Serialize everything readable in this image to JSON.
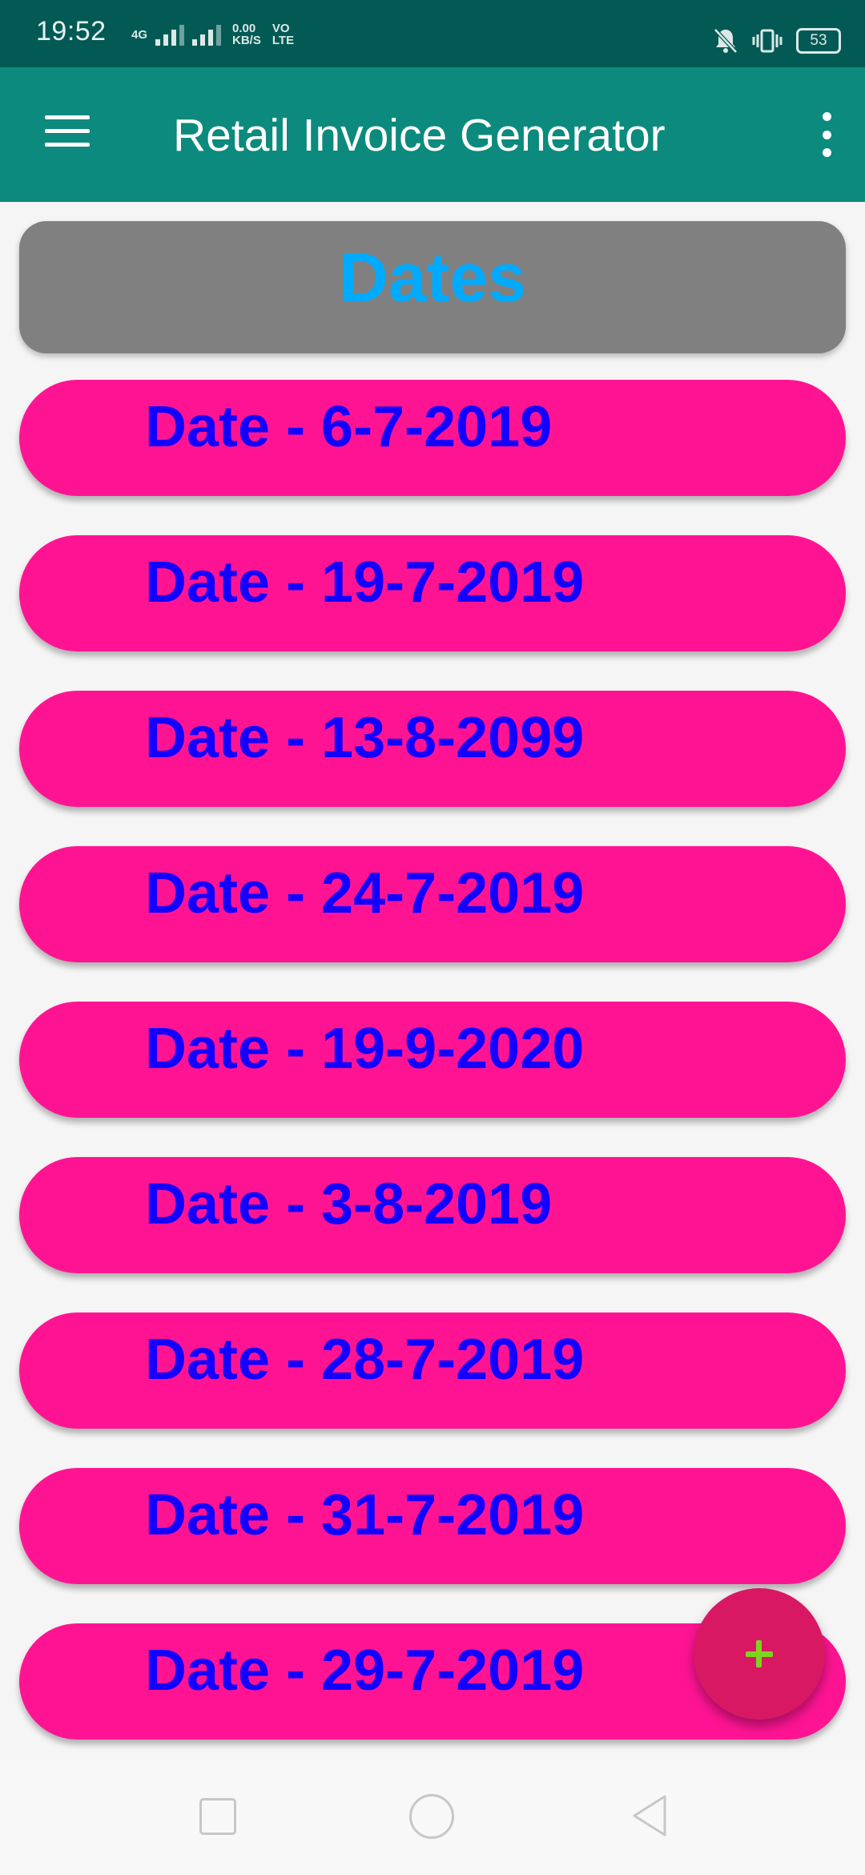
{
  "status_bar": {
    "time": "19:52",
    "network_type": "4G",
    "data_speed_value": "0.00",
    "data_speed_unit": "KB/S",
    "volte_top": "VO",
    "volte_bottom": "LTE",
    "battery_level": "53"
  },
  "app_bar": {
    "title": "Retail Invoice Generator"
  },
  "header": {
    "title": "Dates"
  },
  "dates": [
    "Date - 6-7-2019",
    "Date - 19-7-2019",
    "Date - 13-8-2099",
    "Date - 24-7-2019",
    "Date - 19-9-2020",
    "Date - 3-8-2019",
    "Date - 28-7-2019",
    "Date - 31-7-2019",
    "Date - 29-7-2019"
  ],
  "fab": {
    "label": "+"
  },
  "colors": {
    "status_bar": "#035a55",
    "app_bar": "#0c8a7d",
    "header_card": "#808080",
    "header_text": "#00aaff",
    "date_pill": "#fe1493",
    "date_text": "#1400ff",
    "fab": "#d91864",
    "fab_plus": "#7ed321"
  }
}
